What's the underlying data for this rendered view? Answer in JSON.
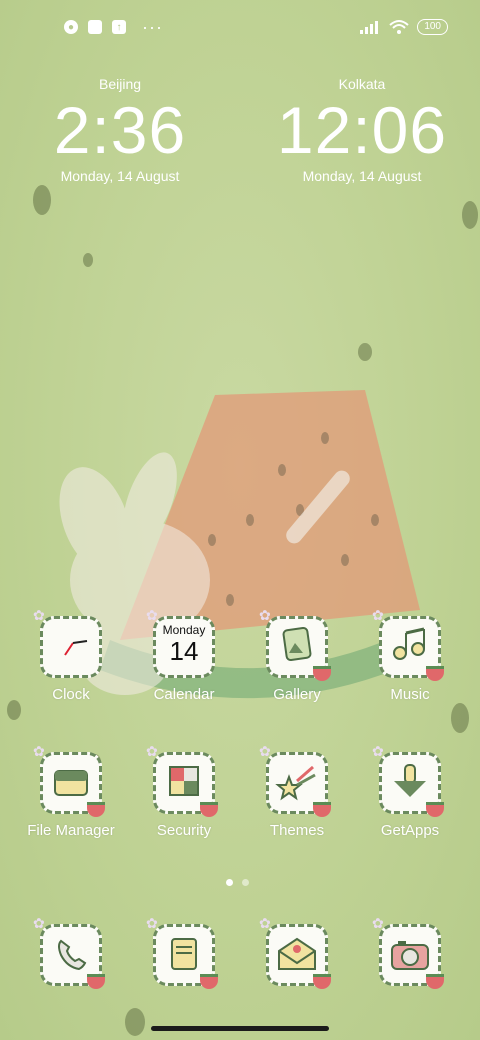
{
  "status_bar": {
    "left_icons": [
      "notification-icon",
      "square-icon",
      "upload-icon"
    ],
    "more": "···",
    "battery": "100"
  },
  "clocks": [
    {
      "city": "Beijing",
      "time": "2:36",
      "date": "Monday, 14 August"
    },
    {
      "city": "Kolkata",
      "time": "12:06",
      "date": "Monday, 14 August"
    }
  ],
  "apps": {
    "row1": [
      {
        "label": "Clock"
      },
      {
        "label": "Calendar",
        "day_name": "Monday",
        "day_num": "14"
      },
      {
        "label": "Gallery"
      },
      {
        "label": "Music"
      }
    ],
    "row2": [
      {
        "label": "File Manager"
      },
      {
        "label": "Security"
      },
      {
        "label": "Themes"
      },
      {
        "label": "GetApps"
      }
    ]
  },
  "dock": [
    "phone-icon",
    "notes-icon",
    "messages-icon",
    "camera-icon"
  ],
  "page_indicator": {
    "count": 2,
    "active": 1
  },
  "colors": {
    "background": "#bfd294",
    "icon_border": "#6b8a5e",
    "watermelon": "#e0686a"
  }
}
